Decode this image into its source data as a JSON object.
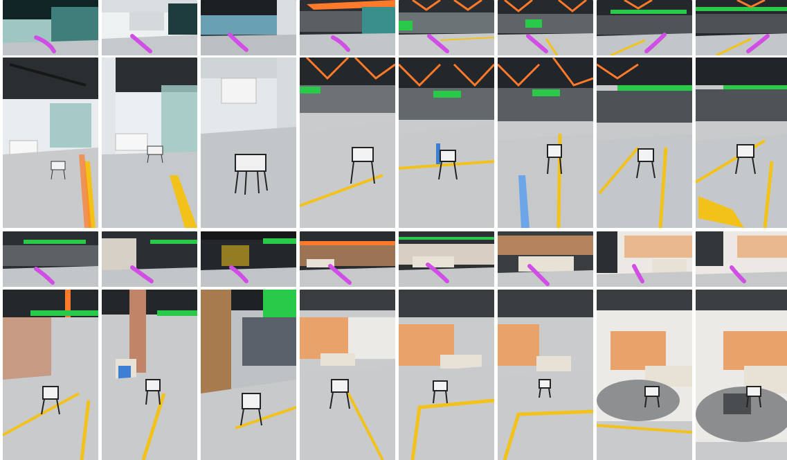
{
  "grid": {
    "rows": [
      {
        "id": "route-1-thumbnails",
        "count": 8
      },
      {
        "id": "route-1-robot-views",
        "count": 8
      },
      {
        "id": "route-2-thumbnails",
        "count": 8
      },
      {
        "id": "route-2-robot-views",
        "count": 8
      }
    ]
  },
  "colors": {
    "floor": "#c9cbcd",
    "wall_white": "#e8ecee",
    "ceiling": "#2a2d30",
    "accent_orange": "#ff7a2a",
    "accent_green": "#29c94a",
    "lane_yellow": "#f2c21b",
    "path_trace": "#d14ee6",
    "robot_white": "#f3f3f3",
    "glass": "#9fc6c2",
    "sofa": "#e7e1d6",
    "mural": "#e9a36a"
  }
}
